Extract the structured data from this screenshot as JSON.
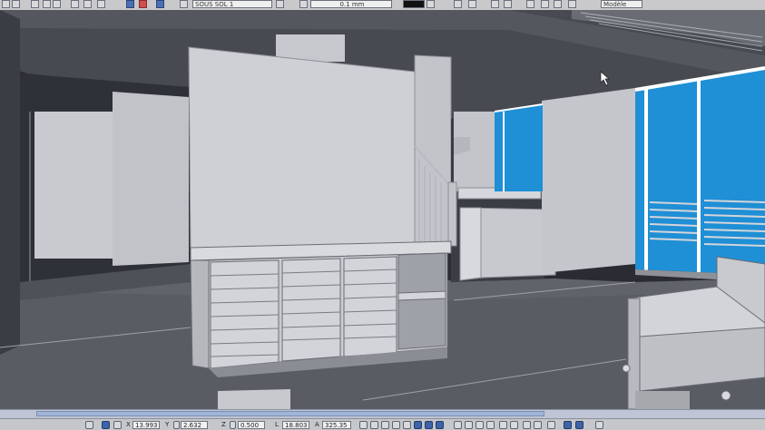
{
  "toolbar": {
    "layer_combo": "SOUS SOL 1",
    "line_weight_combo": "0.1 mm",
    "view_combo": "Modèle"
  },
  "statusbar": {
    "x_label": "X",
    "x_value": "13.993",
    "y_label": "Y",
    "y_value": "2.632",
    "z_label": "Z",
    "z_value": "0.500",
    "l_label": "L",
    "l_value": "18.803",
    "a_label": "A",
    "a_value": "325.35"
  },
  "colors": {
    "sky": "#1f8fd6",
    "wall_light": "#c8c9cf",
    "ceiling": "#4d4f57",
    "floor": "#5d5f67",
    "window_frame": "#ffffff"
  },
  "icons": {
    "toolbar": [
      "save-icon",
      "cut-icon",
      "copy-icon",
      "paste-icon",
      "undo-icon",
      "redo-icon",
      "favorite-icon",
      "record-icon",
      "help-icon"
    ],
    "statusbar": [
      "snap-icon",
      "lock-icon",
      "zoom-in-icon",
      "zoom-out-icon",
      "pan-icon",
      "orbit-icon",
      "walk-icon",
      "render-icon"
    ]
  }
}
